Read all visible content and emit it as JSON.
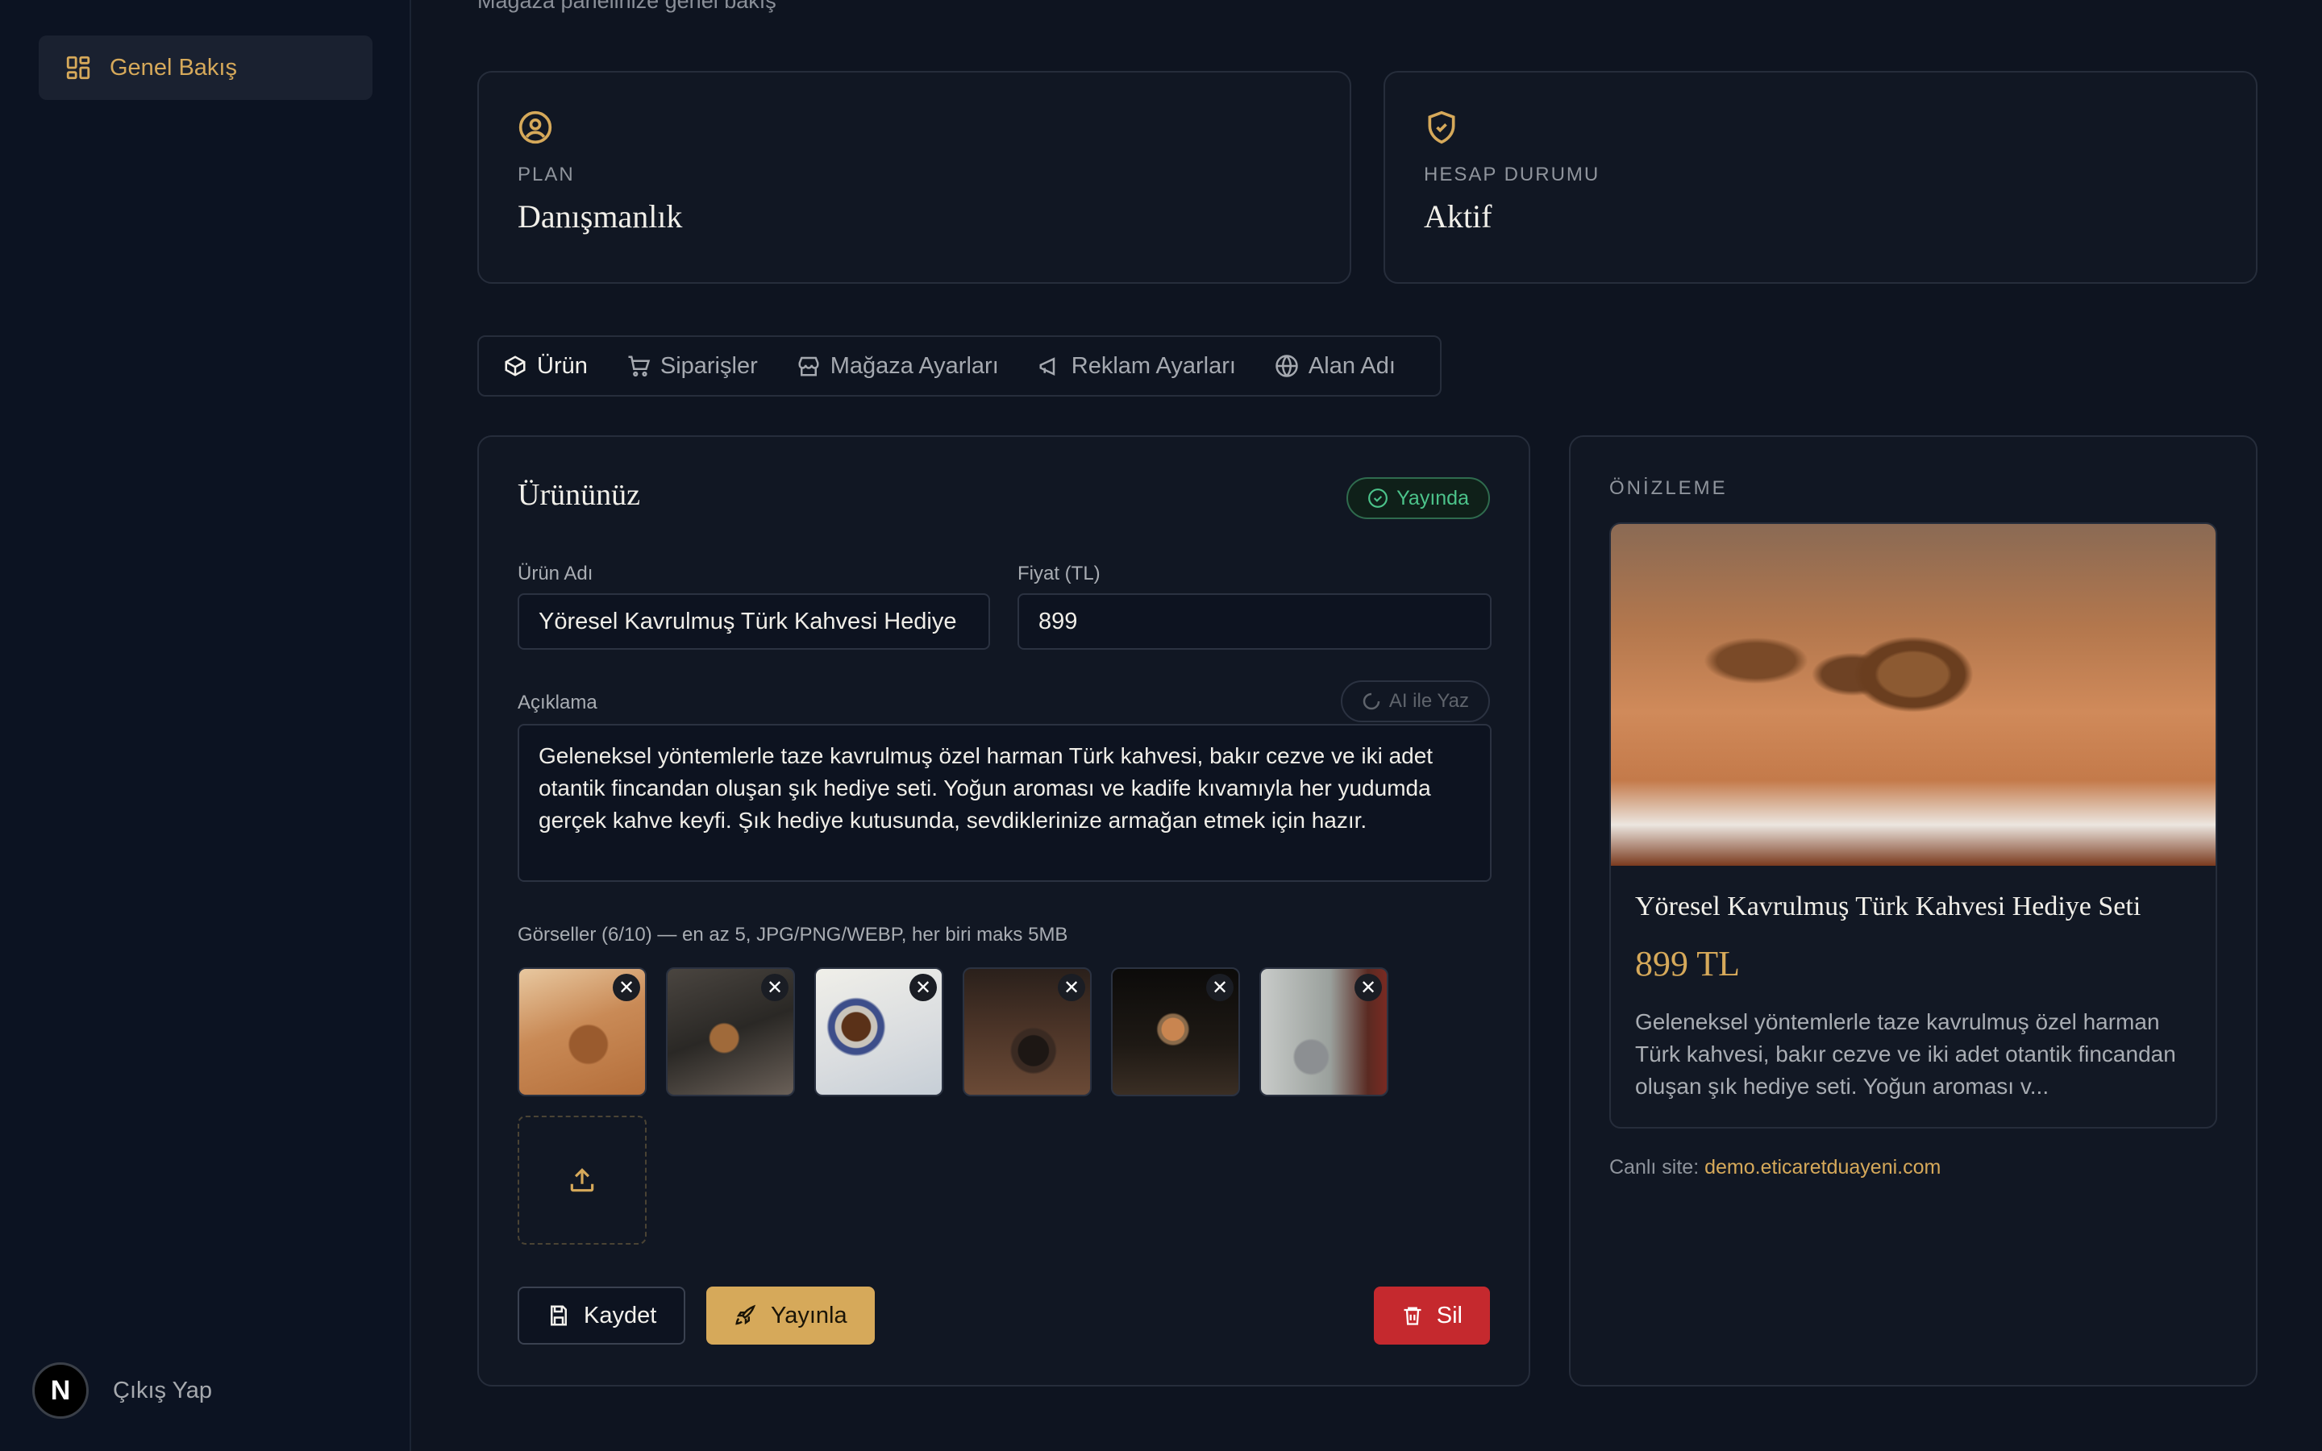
{
  "sidebar": {
    "nav_label": "Genel Bakış",
    "logout_label": "Çıkış Yap",
    "badge_letter": "N"
  },
  "header": {
    "subtitle": "Mağaza panelinize genel bakış"
  },
  "stats": {
    "plan": {
      "label": "PLAN",
      "value": "Danışmanlık"
    },
    "status": {
      "label": "HESAP DURUMU",
      "value": "Aktif"
    }
  },
  "tabs": [
    {
      "label": "Ürün"
    },
    {
      "label": "Siparişler"
    },
    {
      "label": "Mağaza Ayarları"
    },
    {
      "label": "Reklam Ayarları"
    },
    {
      "label": "Alan Adı"
    }
  ],
  "form": {
    "title": "Ürününüz",
    "status_badge": "Yayında",
    "name_label": "Ürün Adı",
    "name_value": "Yöresel Kavrulmuş Türk Kahvesi Hediye",
    "price_label": "Fiyat (TL)",
    "price_value": "899",
    "desc_label": "Açıklama",
    "ai_button": "AI ile Yaz",
    "desc_value": "Geleneksel yöntemlerle taze kavrulmuş özel harman Türk kahvesi, bakır cezve ve iki adet otantik fincandan oluşan şık hediye seti. Yoğun aroması ve kadife kıvamıyla her yudumda gerçek kahve keyfi. Şık hediye kutusunda, sevdiklerinize armağan etmek için hazır.",
    "images_label": "Görseller (6/10) — en az 5, JPG/PNG/WEBP, her biri maks 5MB",
    "save_label": "Kaydet",
    "publish_label": "Yayınla",
    "delete_label": "Sil"
  },
  "preview": {
    "heading": "ÖNİZLEME",
    "product_title": "Yöresel Kavrulmuş Türk Kahvesi Hediye Seti",
    "price": "899 TL",
    "description": "Geleneksel yöntemlerle taze kavrulmuş özel harman Türk kahvesi, bakır cezve ve iki adet otantik fincandan oluşan şık hediye seti. Yoğun aroması v...",
    "live_label": "Canlı site:",
    "live_url": "demo.eticaretduayeni.com"
  },
  "colors": {
    "accent": "#d6a95a",
    "success": "#4cc38a",
    "danger": "#c5292e",
    "bg": "#0e1420"
  }
}
